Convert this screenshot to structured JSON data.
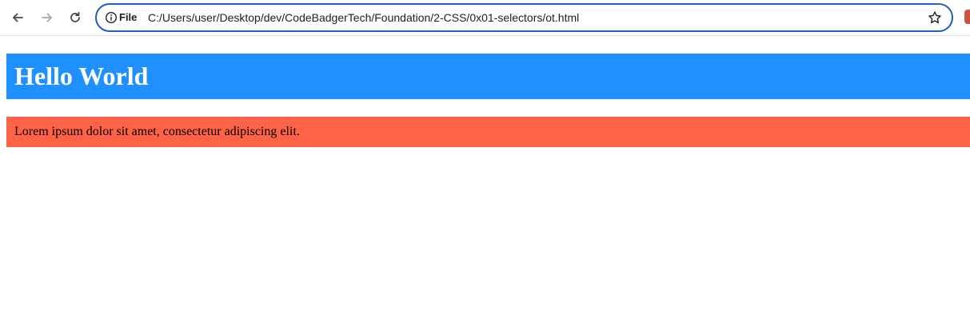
{
  "browser": {
    "scheme_label": "File",
    "url": "C:/Users/user/Desktop/dev/CodeBadgerTech/Foundation/2-CSS/0x01-selectors/ot.html",
    "icons": {
      "back": "back-arrow-icon",
      "forward": "forward-arrow-icon",
      "reload": "reload-icon",
      "info": "info-icon",
      "bookmark": "star-icon"
    },
    "colors": {
      "omnibox_border": "#1a5fc1"
    }
  },
  "page": {
    "heading": "Hello World",
    "paragraph": "Lorem ipsum dolor sit amet, consectetur adipiscing elit.",
    "colors": {
      "heading_bg": "#1e90ff",
      "heading_text": "#ffffff",
      "paragraph_bg": "#ff6347"
    }
  }
}
